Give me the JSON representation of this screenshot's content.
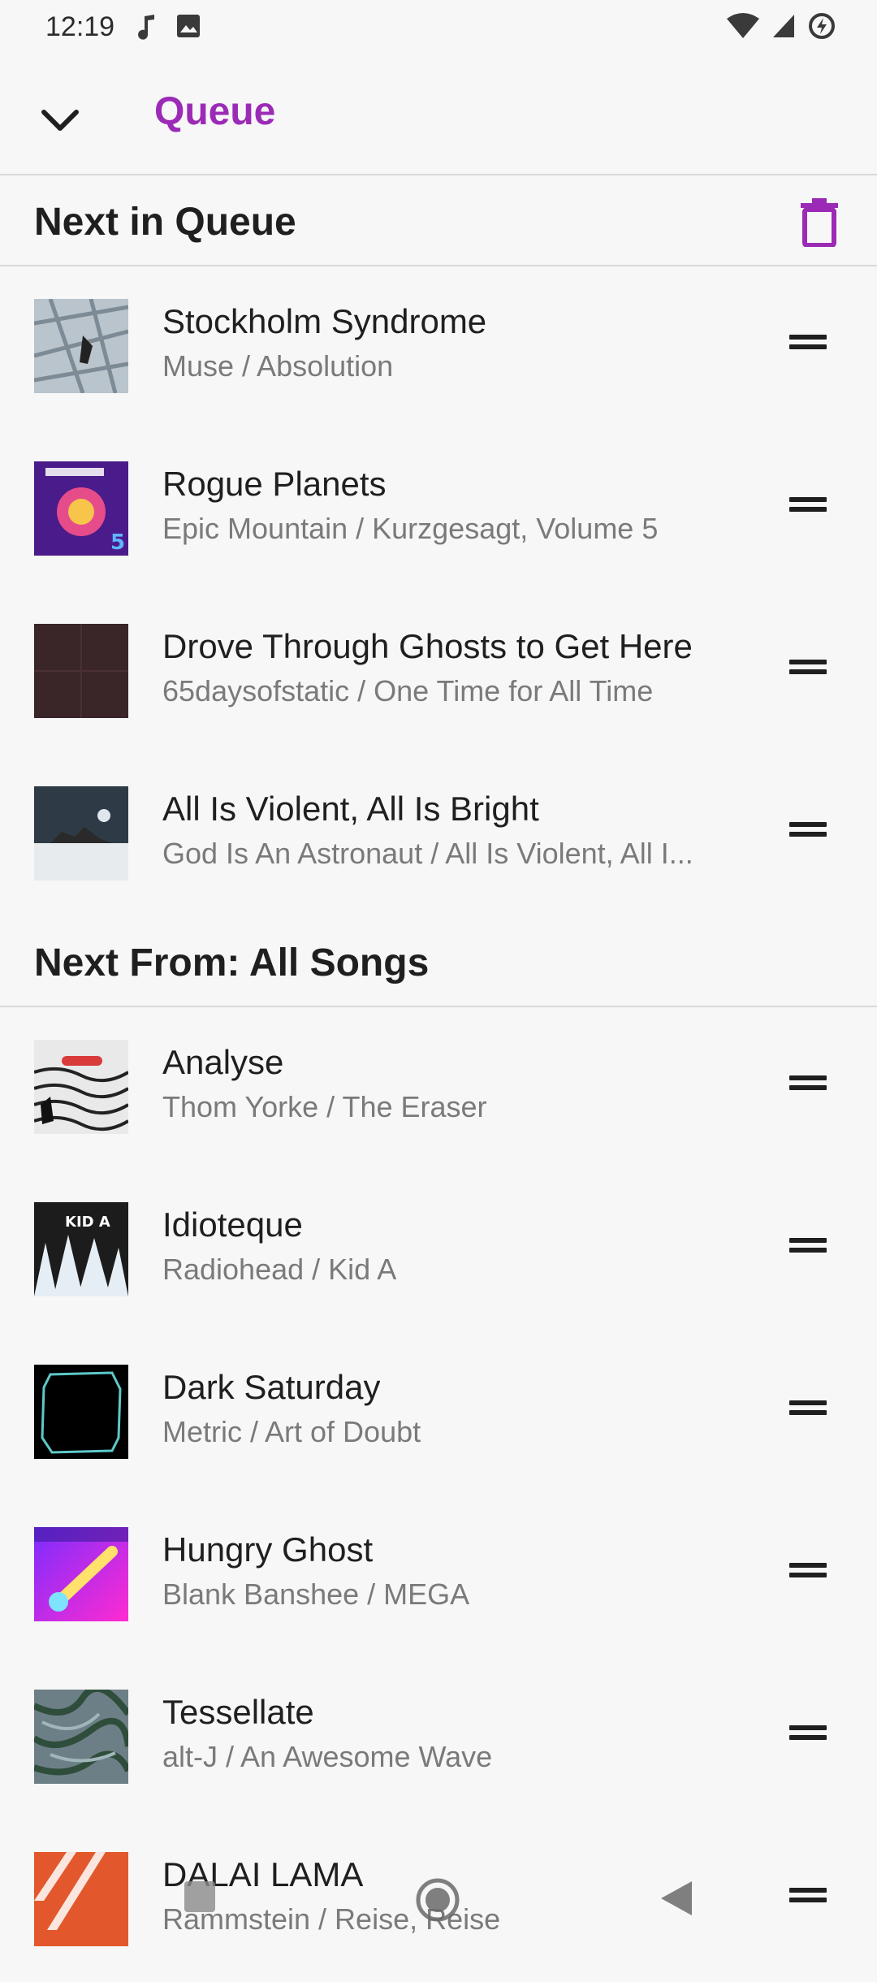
{
  "status_bar": {
    "time": "12:19",
    "left_icons": [
      "music-note-icon",
      "image-icon"
    ],
    "right_icons": [
      "wifi-icon",
      "signal-icon",
      "battery-saver-icon"
    ]
  },
  "app_bar": {
    "title": "Queue",
    "accent_color": "#9b2bb6"
  },
  "sections": [
    {
      "title": "Next in Queue",
      "action_icon": "trash-icon",
      "items": [
        {
          "title": "Stockholm Syndrome",
          "subtitle": "Muse / Absolution",
          "art": "art-absolution"
        },
        {
          "title": "Rogue Planets",
          "subtitle": "Epic Mountain / Kurzgesagt, Volume 5",
          "art": "art-kurzgesagt"
        },
        {
          "title": "Drove Through Ghosts to Get Here",
          "subtitle": "65daysofstatic / One Time for All Time",
          "art": "art-onetime"
        },
        {
          "title": "All Is Violent, All Is Bright",
          "subtitle": "God Is An Astronaut / All Is Violent, All I...",
          "art": "art-allisviolent"
        }
      ]
    },
    {
      "title": "Next From: All Songs",
      "items": [
        {
          "title": "Analyse",
          "subtitle": "Thom Yorke / The Eraser",
          "art": "art-eraser"
        },
        {
          "title": "Idioteque",
          "subtitle": "Radiohead / Kid A",
          "art": "art-kida"
        },
        {
          "title": "Dark Saturday",
          "subtitle": "Metric / Art of Doubt",
          "art": "art-artofdoubt"
        },
        {
          "title": "Hungry Ghost",
          "subtitle": "Blank Banshee / MEGA",
          "art": "art-mega"
        },
        {
          "title": "Tessellate",
          "subtitle": "alt-J / An Awesome Wave",
          "art": "art-awesomewave"
        },
        {
          "title": "DALAI LAMA",
          "subtitle": "Rammstein / Reise, Reise",
          "art": "art-reise"
        }
      ]
    }
  ],
  "nav_bar": {
    "icons": [
      "recents-icon",
      "home-icon",
      "back-icon"
    ]
  }
}
